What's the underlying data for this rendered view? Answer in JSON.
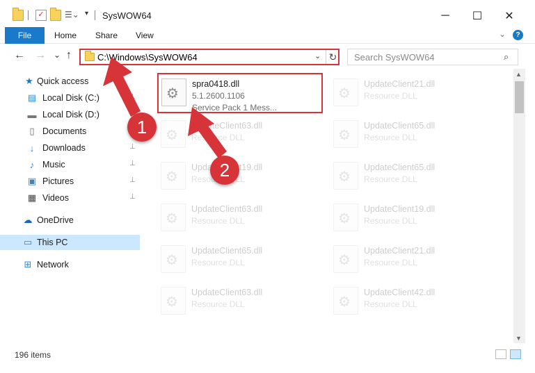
{
  "window": {
    "title": "SysWOW64",
    "minimize_glyph": "─",
    "maximize_glyph": "☐",
    "close_glyph": "✕"
  },
  "ribbon": {
    "file_tab": "File",
    "tabs": [
      "Home",
      "Share",
      "View"
    ],
    "help_glyph": "?",
    "collapse_glyph": "⌄"
  },
  "navigation": {
    "back_glyph": "←",
    "forward_glyph": "→",
    "recent_glyph": "⌄",
    "up_glyph": "↑",
    "address_path": "C:\\Windows\\SysWOW64",
    "address_dropdown_glyph": "⌄",
    "refresh_glyph": "↻",
    "search_placeholder": "Search SysWOW64",
    "search_glyph": "⌕"
  },
  "sidebar": {
    "items": [
      {
        "label": "Quick access",
        "icon": "star-icon",
        "glyph": "★",
        "color": "#1979ca",
        "pinned": false
      },
      {
        "label": "Local Disk (C:)",
        "icon": "windows-drive-icon",
        "glyph": "▤",
        "color": "#2b88d8",
        "pinned": true
      },
      {
        "label": "Local Disk (D:)",
        "icon": "drive-icon",
        "glyph": "▬",
        "color": "#777777",
        "pinned": false
      },
      {
        "label": "Documents",
        "icon": "documents-icon",
        "glyph": "▯",
        "color": "#5a6f85",
        "pinned": false
      },
      {
        "label": "Downloads",
        "icon": "download-arrow-icon",
        "glyph": "↓",
        "color": "#2b88d8",
        "pinned": true
      },
      {
        "label": "Music",
        "icon": "music-note-icon",
        "glyph": "♪",
        "color": "#2b88d8",
        "pinned": true
      },
      {
        "label": "Pictures",
        "icon": "pictures-icon",
        "glyph": "▣",
        "color": "#4c7fb0",
        "pinned": true
      },
      {
        "label": "Videos",
        "icon": "film-icon",
        "glyph": "▦",
        "color": "#444444",
        "pinned": true
      },
      {
        "label": "OneDrive",
        "icon": "cloud-icon",
        "glyph": "☁",
        "color": "#1565c0",
        "pinned": false
      },
      {
        "label": "This PC",
        "icon": "monitor-icon",
        "glyph": "▭",
        "color": "#2b88d8",
        "pinned": false,
        "selected": true
      },
      {
        "label": "Network",
        "icon": "network-icon",
        "glyph": "⊞",
        "color": "#2b88d8",
        "pinned": false
      }
    ],
    "pin_glyph": "📌"
  },
  "files": {
    "highlighted": {
      "name": "spra0418.dll",
      "version": "5.1.2600.1106",
      "description": "Service Pack 1 Mess..."
    },
    "background": [
      {
        "name": "UpdateClient21.dll",
        "type": "Resource DLL"
      },
      {
        "name": "UpdateClient63.dll",
        "type": "Resource DLL"
      },
      {
        "name": "UpdateClient65.dll",
        "type": "Resource DLL"
      },
      {
        "name": "UpdateClient19.dll",
        "type": "Resource DLL"
      },
      {
        "name": "UpdateClient65.dll",
        "type": "Resource DLL"
      },
      {
        "name": "UpdateClient63.dll",
        "type": "Resource DLL"
      },
      {
        "name": "UpdateClient19.dll",
        "type": "Resource DLL"
      },
      {
        "name": "UpdateClient65.dll",
        "type": "Resource DLL"
      },
      {
        "name": "UpdateClient21.dll",
        "type": "Resource DLL"
      },
      {
        "name": "UpdateClient63.dll",
        "type": "Resource DLL"
      },
      {
        "name": "UpdateClient42.dll",
        "type": "Resource DLL"
      }
    ]
  },
  "scrollbar": {
    "up_glyph": "▲",
    "down_glyph": "▼"
  },
  "status": {
    "item_count": "196 items"
  },
  "callouts": [
    {
      "number": "1"
    },
    {
      "number": "2"
    }
  ],
  "colors": {
    "accent": "#1979ca",
    "highlight_red": "#d7343a",
    "selection": "#cce8ff"
  }
}
